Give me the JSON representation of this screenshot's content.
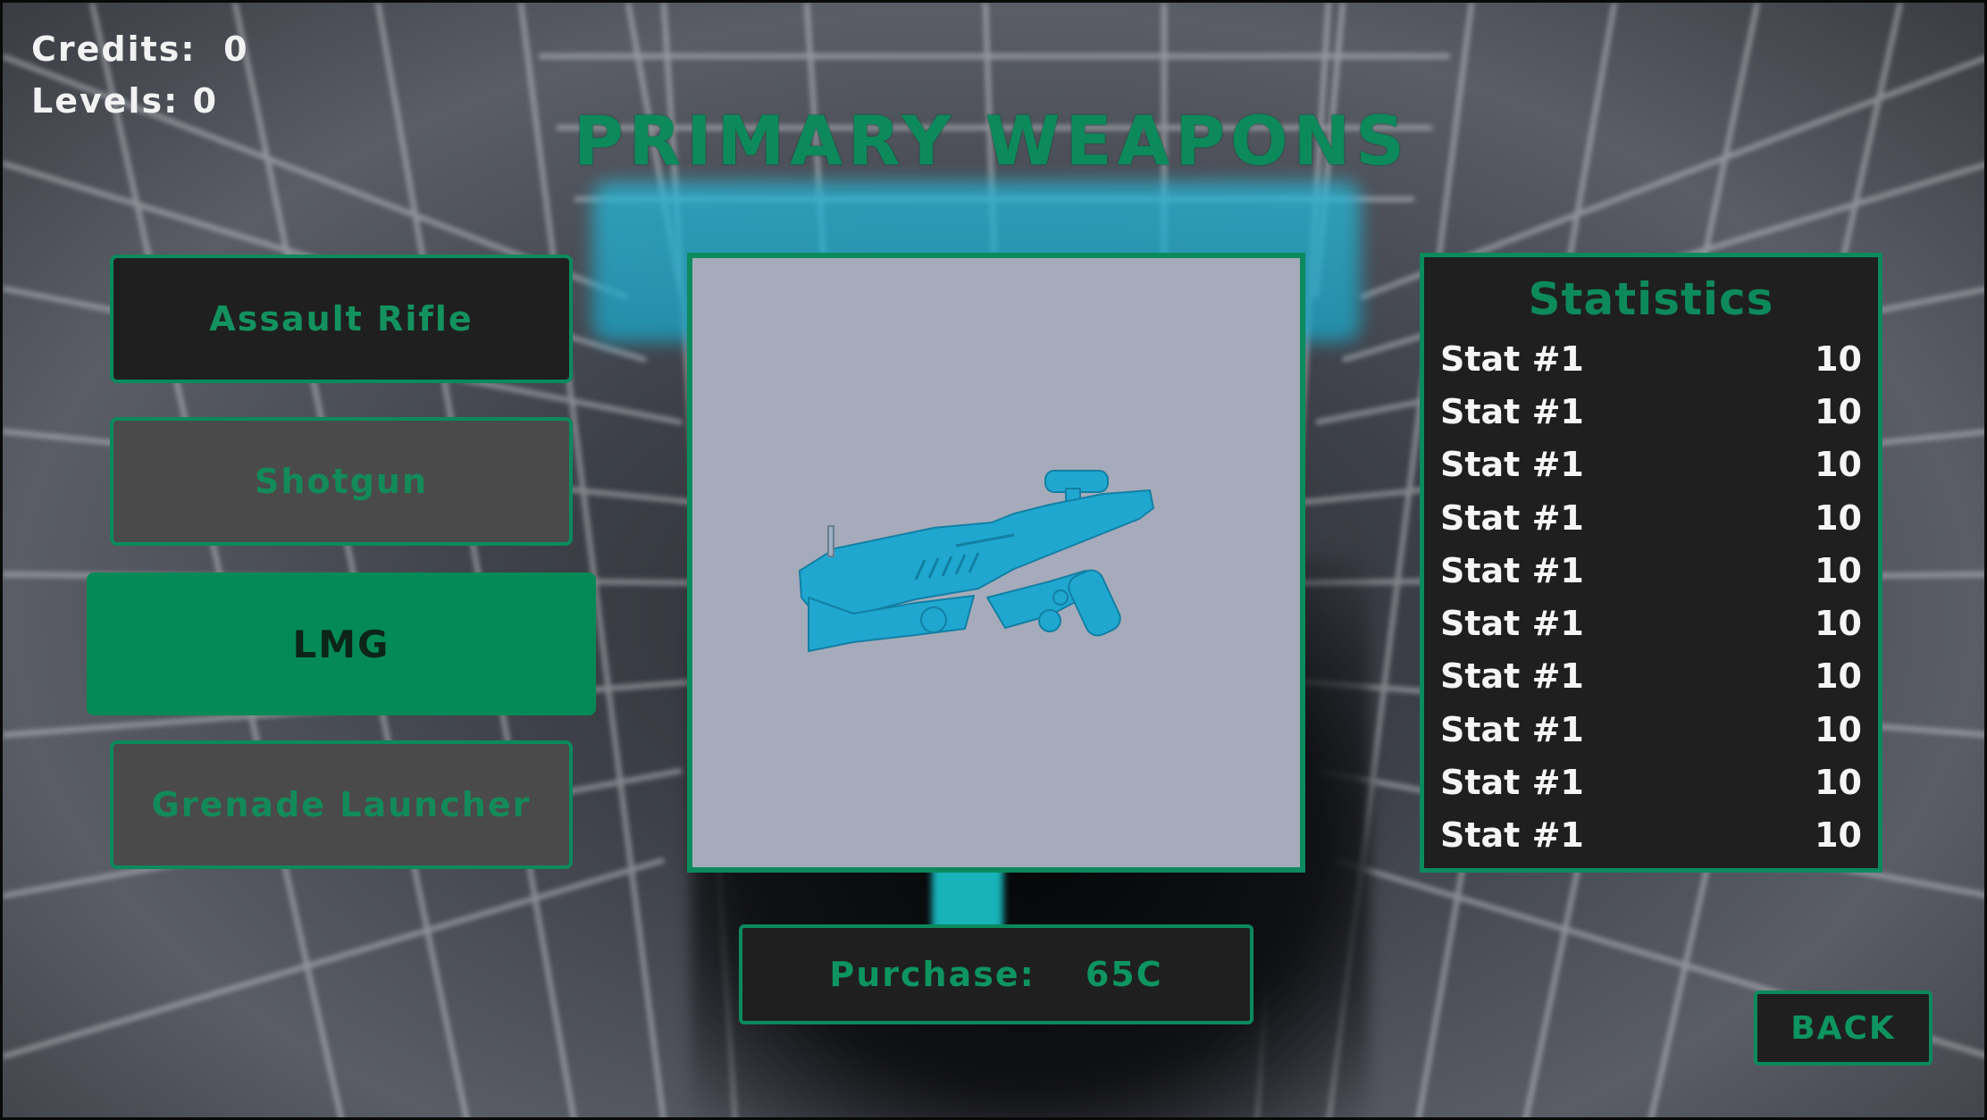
{
  "hud": {
    "credits_label": "Credits:",
    "credits_value": "0",
    "levels_label": "Levels:",
    "levels_value": "0"
  },
  "title": "PRIMARY WEAPONS",
  "weapons": [
    {
      "label": "Assault Rifle",
      "state": "default"
    },
    {
      "label": "Shotgun",
      "state": "disabled"
    },
    {
      "label": "LMG",
      "state": "selected"
    },
    {
      "label": "Grenade Launcher",
      "state": "disabled"
    }
  ],
  "preview": {
    "icon": "weapon-model-icon"
  },
  "statistics": {
    "title": "Statistics",
    "rows": [
      {
        "name": "Stat #1",
        "value": "10"
      },
      {
        "name": "Stat #1",
        "value": "10"
      },
      {
        "name": "Stat #1",
        "value": "10"
      },
      {
        "name": "Stat #1",
        "value": "10"
      },
      {
        "name": "Stat #1",
        "value": "10"
      },
      {
        "name": "Stat #1",
        "value": "10"
      },
      {
        "name": "Stat #1",
        "value": "10"
      },
      {
        "name": "Stat #1",
        "value": "10"
      },
      {
        "name": "Stat #1",
        "value": "10"
      },
      {
        "name": "Stat #1",
        "value": "10"
      }
    ]
  },
  "purchase": {
    "label": "Purchase:",
    "price": "65C"
  },
  "back_label": "BACK",
  "colors": {
    "accent_green": "#0b8a5d",
    "selected_green": "#048a55",
    "panel_dark": "#1f1f1f",
    "panel_disabled": "#4a4a4a",
    "gun_cyan": "#1fa7d0",
    "preview_bg": "#a6abbb"
  }
}
